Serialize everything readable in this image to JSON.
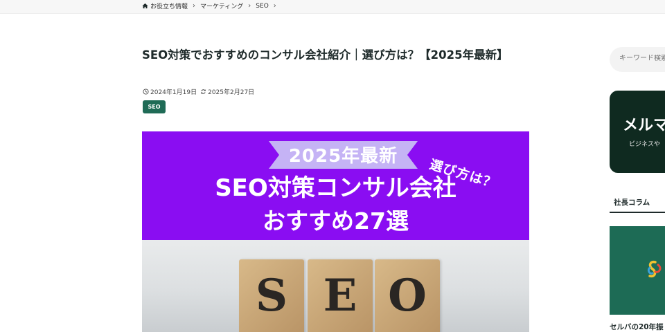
{
  "breadcrumb": {
    "items": [
      "お役立ち情報",
      "マーケティング",
      "SEO"
    ]
  },
  "article": {
    "title": "SEO対策でおすすめのコンサル会社紹介｜選び方は？【2025年最新】",
    "published": "2024年1月19日",
    "updated": "2025年2月27日",
    "tag": "SEO"
  },
  "eyecatch": {
    "ribbon": "2025年最新",
    "side": "選び方は？",
    "line1": "SEO対策コンサル会社",
    "line2": "おすすめ27選",
    "blocks": [
      "S",
      "E",
      "O"
    ]
  },
  "sidebar": {
    "search_placeholder": "キーワード検索",
    "mail_title": "メルマ",
    "mail_sub": "ビジネスや",
    "column_heading": "社長コラム",
    "card_caption": "セルバの20年振"
  },
  "colors": {
    "accent": "#1f6b56",
    "eyecatch_purple": "#8a0df2",
    "mail_bg": "#0f2a20"
  }
}
